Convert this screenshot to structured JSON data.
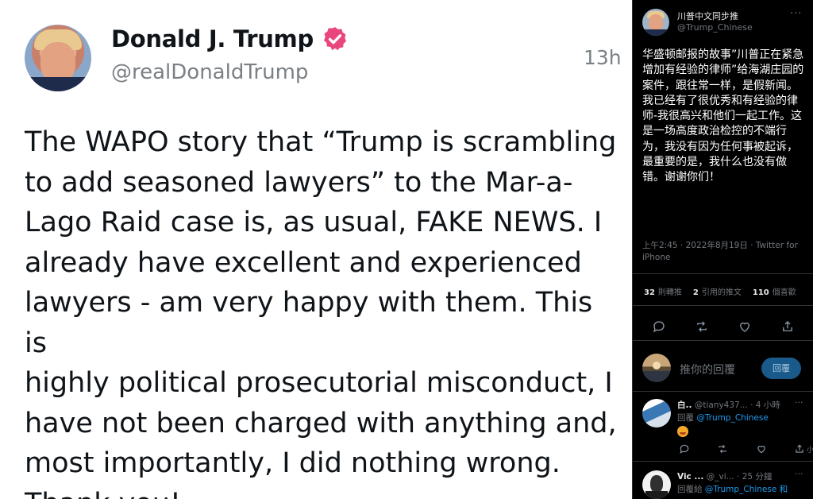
{
  "main_tweet": {
    "display_name": "Donald J. Trump",
    "handle": "@realDonaldTrump",
    "timestamp": "13h",
    "text": "The WAPO story that “Trump is scrambling\nto add seasoned lawyers” to the Mar-a-\nLago Raid case is, as usual, FAKE NEWS. I\nalready have excellent and experienced\nlawyers - am very happy with them. This is\nhighly political prosecutorial misconduct, I\nhave not been charged with anything and,\nmost importantly, I did nothing wrong.\nThank you!",
    "verified_color": "#e8467c"
  },
  "side_tweet": {
    "display_name": "川普中文同步推",
    "handle": "@Trump_Chinese",
    "more": "···",
    "text": "华盛顿邮报的故事”川普正在紧急增加有经验的律师”给海湖庄园的案件，跟往常一样，是假新闻。我已经有了很优秀和有经验的律师-我很高兴和他们一起工作。这是一场高度政治检控的不端行为，我没有因为任何事被起诉，最重要的是，我什么也没有做错。谢谢你们！",
    "meta": "上午2:45 · 2022年8月19日 · Twitter for iPhone",
    "stats": {
      "retweets_count": "32",
      "retweets_label": "則轉推",
      "quotes_count": "2",
      "quotes_label": "引用的推文",
      "likes_count": "110",
      "likes_label": "個喜歡"
    },
    "reply_placeholder": "推你的回覆",
    "reply_button": "回覆"
  },
  "comments": [
    {
      "name": "白..",
      "handle": "@tiany437...",
      "time": "· 4 小時",
      "reply_prefix": "回覆",
      "reply_to": "@Trump_Chinese",
      "more": "···",
      "share_label": "小"
    },
    {
      "name": "Vic ...",
      "handle": "@_vi...",
      "time": "· 25 分鐘",
      "reply_prefix": "回覆給",
      "reply_to": "@Trump_Chinese 和",
      "more": "···"
    }
  ],
  "colors": {
    "accent": "#1d9bf0",
    "muted": "#71767b",
    "dark_bg": "#000000"
  }
}
